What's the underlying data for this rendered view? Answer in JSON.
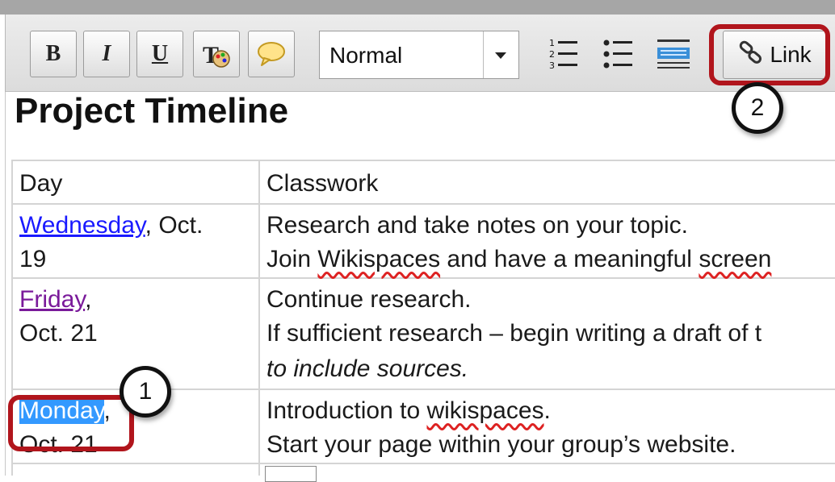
{
  "toolbar": {
    "bold_label": "B",
    "italic_label": "I",
    "underline_label": "U",
    "style_select_value": "Normal",
    "link_label": "Link",
    "icons": [
      "text-color-icon",
      "comment-icon",
      "numbered-list-icon",
      "bullet-list-icon",
      "indent-icon",
      "link-icon",
      "dropdown-arrow-icon"
    ]
  },
  "page": {
    "title": "Project Timeline"
  },
  "table": {
    "header": {
      "day": "Day",
      "classwork": "Classwork"
    },
    "rows": [
      {
        "day_link": "Wednesday",
        "day_rest1": ", Oct.",
        "day_rest2": "19",
        "line1": "Research and take notes on your topic.",
        "line2_a": "Join ",
        "line2_b": "Wikispaces",
        "line2_c": " and have a meaningful ",
        "line2_d": "screen"
      },
      {
        "day_link": "Friday",
        "day_rest1": ",",
        "day_rest2": "Oct. 21",
        "line1": "Continue research.",
        "line2": "If sufficient research – begin writing a draft of t",
        "line3": "to include sources."
      },
      {
        "day_link": "Monday",
        "day_rest1": ",",
        "day_rest2": "Oct. 21",
        "line1_a": "Introduction to ",
        "line1_b": "wikispaces",
        "line1_c": ".",
        "line2": "Start your page within your group’s website."
      }
    ]
  },
  "annotations": {
    "callout_1": "1",
    "callout_2": "2"
  },
  "colors": {
    "highlight": "#b1151c",
    "selection": "#3399ff",
    "link": "#1a1aff",
    "visited_link": "#7a1a9a"
  }
}
